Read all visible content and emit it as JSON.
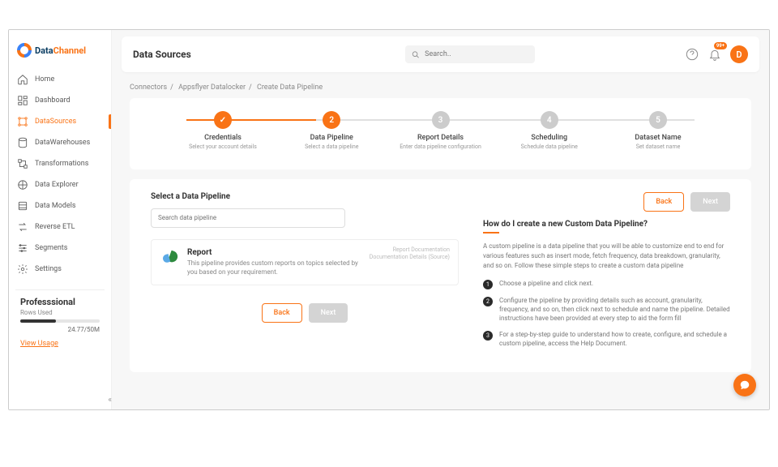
{
  "brand": {
    "part1": "Data",
    "part2": "Channel"
  },
  "header": {
    "title": "Data Sources",
    "search_placeholder": "Search..",
    "notif_badge": "99+",
    "avatar_initial": "D"
  },
  "sidebar": {
    "items": [
      {
        "label": "Home"
      },
      {
        "label": "Dashboard"
      },
      {
        "label": "DataSources"
      },
      {
        "label": "DataWarehouses"
      },
      {
        "label": "Transformations"
      },
      {
        "label": "Data Explorer"
      },
      {
        "label": "Data Models"
      },
      {
        "label": "Reverse ETL"
      },
      {
        "label": "Segments"
      },
      {
        "label": "Settings"
      }
    ],
    "active_index": 2,
    "plan": {
      "title": "Professsional",
      "sub": "Rows Used",
      "usage": "24.77/50M",
      "link": "View Usage"
    }
  },
  "breadcrumb": {
    "items": [
      "Connectors",
      "Appsflyer Datalocker",
      "Create Data Pipeline"
    ]
  },
  "stepper": [
    {
      "label": "Credentials",
      "sub": "Select your account details",
      "state": "done",
      "num": "✓"
    },
    {
      "label": "Data Pipeline",
      "sub": "Select a data pipeline",
      "state": "active",
      "num": "2"
    },
    {
      "label": "Report Details",
      "sub": "Enter data pipeline configuration",
      "state": "pending",
      "num": "3"
    },
    {
      "label": "Scheduling",
      "sub": "Schedule data pipeline",
      "state": "pending",
      "num": "4"
    },
    {
      "label": "Dataset Name",
      "sub": "Set dataset name",
      "state": "pending",
      "num": "5"
    }
  ],
  "select_section": {
    "title": "Select a Data Pipeline",
    "search_placeholder": "Search data pipeline",
    "pipeline": {
      "title": "Report",
      "desc": "This pipeline provides custom reports on topics selected by you based on your requirement.",
      "link1": "Report Documentation",
      "link2": "Documentation Details (Source)"
    },
    "back_label": "Back",
    "next_label": "Next"
  },
  "help": {
    "title": "How do I create a new Custom Data Pipeline?",
    "intro": "A custom pipeline is a data pipeline that you will be able to customize end to end for various features such as insert mode, fetch frequency, data breakdown, granularity, and so on. Follow these simple steps to create a custom data pipeline",
    "steps": [
      "Choose a pipeline and click next.",
      "Configure the pipeline by providing details such as account, granularity, frequency, and so on, then click next to schedule and name the pipeline. Detailed instructions have been provided at every step to aid the form fill",
      "For a step-by-step guide to understand how to create, configure, and schedule a custom pipeline, access the Help Document."
    ]
  },
  "colors": {
    "accent": "#f97316"
  }
}
